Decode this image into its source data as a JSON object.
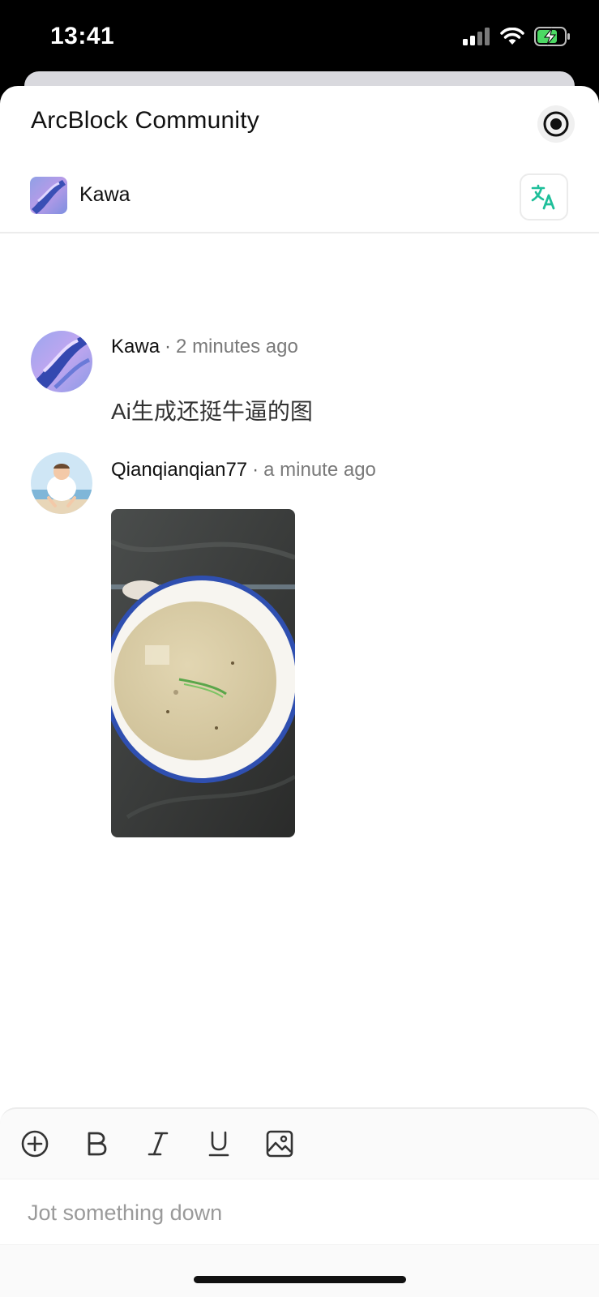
{
  "status_bar": {
    "time": "13:41",
    "icons": [
      "cellular-signal-icon",
      "wifi-icon",
      "battery-charging-icon"
    ]
  },
  "header": {
    "title": "ArcBlock Community",
    "record_icon": "record-icon"
  },
  "channel": {
    "name": "Kawa",
    "translate_icon": "translate-icon"
  },
  "messages": [
    {
      "author": "Kawa",
      "separator": "·",
      "time": "2 minutes ago",
      "text": "Ai生成还挺牛逼的图"
    },
    {
      "author": "Qianqianqian77",
      "separator": "·",
      "time": "a minute ago",
      "attachment": "photo"
    }
  ],
  "composer": {
    "tools": [
      "add-icon",
      "bold-icon",
      "italic-icon",
      "underline-icon",
      "image-icon"
    ],
    "placeholder": "Jot something down"
  },
  "colors": {
    "accent_translate": "#1fbf9a",
    "background": "#ffffff",
    "status_bar": "#000000"
  }
}
